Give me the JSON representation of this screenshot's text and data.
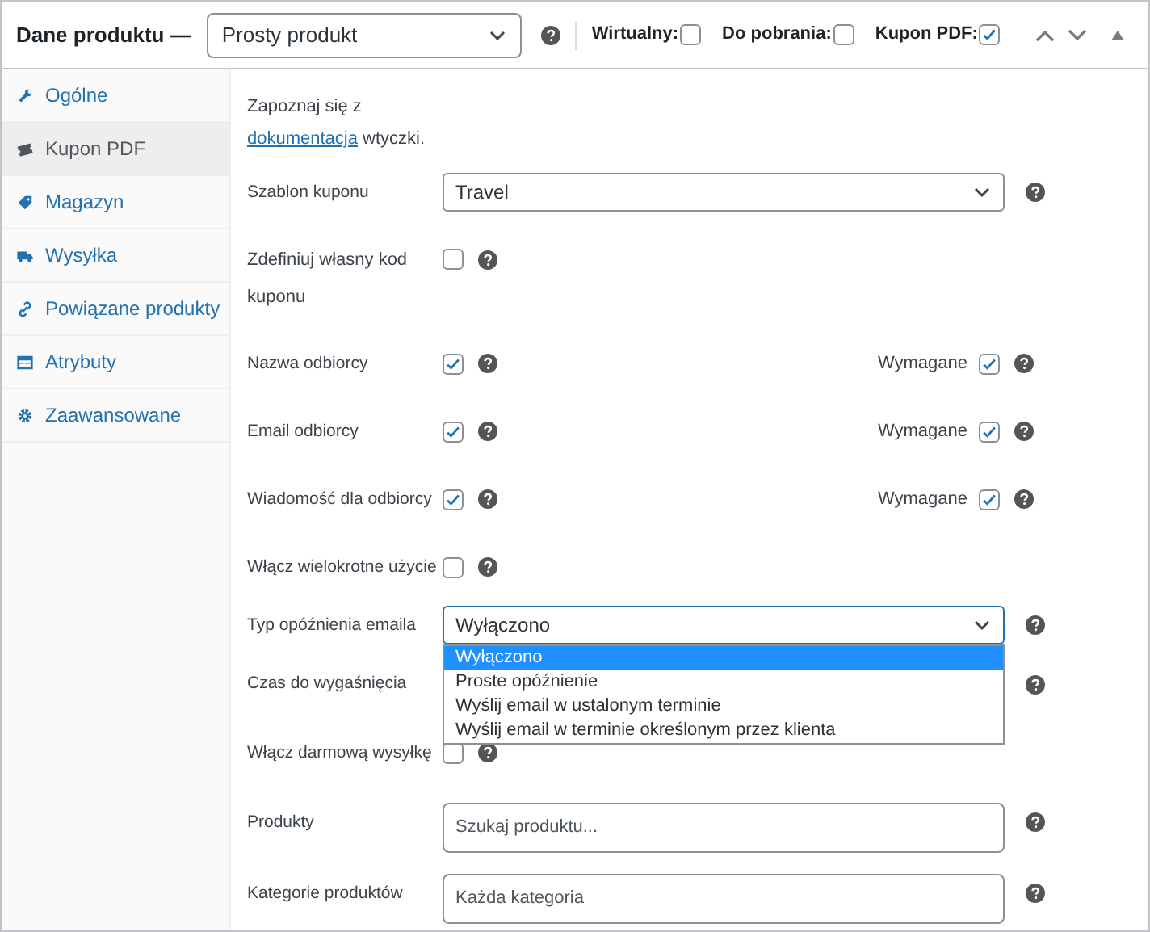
{
  "header": {
    "title": "Dane produktu —",
    "product_type": "Prosty produkt",
    "options": [
      {
        "label": "Wirtualny:",
        "checked": false
      },
      {
        "label": "Do pobrania:",
        "checked": false
      },
      {
        "label": "Kupon PDF:",
        "checked": true
      }
    ]
  },
  "sidebar": {
    "items": [
      {
        "label": "Ogólne",
        "selected": false
      },
      {
        "label": "Kupon PDF",
        "selected": true
      },
      {
        "label": "Magazyn",
        "selected": false
      },
      {
        "label": "Wysyłka",
        "selected": false
      },
      {
        "label": "Powiązane produkty",
        "selected": false
      },
      {
        "label": "Atrybuty",
        "selected": false
      },
      {
        "label": "Zaawansowane",
        "selected": false
      }
    ]
  },
  "panel": {
    "note": {
      "before": "Zapoznaj się z",
      "link": "dokumentacja",
      "after": "wtyczki."
    },
    "fields": [
      {
        "kind": "select",
        "label": "Szablon kuponu",
        "value": "Travel"
      },
      {
        "kind": "checkbox",
        "label": "Zdefiniuj własny kod kuponu",
        "checked": false
      },
      {
        "kind": "checkbox",
        "label": "Nazwa odbiorcy",
        "checked": true,
        "required_label": "Wymagane",
        "required": true
      },
      {
        "kind": "checkbox",
        "label": "Email odbiorcy",
        "checked": true,
        "required_label": "Wymagane",
        "required": true
      },
      {
        "kind": "checkbox",
        "label": "Wiadomość dla odbiorcy",
        "checked": true,
        "required_label": "Wymagane",
        "required": true
      },
      {
        "kind": "checkbox",
        "label": "Włącz wielokrotne użycie",
        "checked": false
      },
      {
        "kind": "dropdown",
        "label": "Typ opóźnienia emaila",
        "value": "Wyłączono",
        "expanded": true,
        "options": [
          {
            "label": "Wyłączono",
            "selected": true
          },
          {
            "label": "Proste opóźnienie",
            "selected": false
          },
          {
            "label": "Wyślij email w ustalonym terminie",
            "selected": false
          },
          {
            "label": "Wyślij email w terminie określonym przez klienta",
            "selected": false
          }
        ]
      },
      {
        "kind": "covered",
        "label": "Czas do wygaśnięcia"
      },
      {
        "kind": "checkbox",
        "label": "Włącz darmową wysyłkę",
        "checked": false
      },
      {
        "kind": "input",
        "label": "Produkty",
        "placeholder": "Szukaj produktu..."
      },
      {
        "kind": "input",
        "label": "Kategorie produktów",
        "placeholder": "Każda kategoria"
      }
    ]
  }
}
